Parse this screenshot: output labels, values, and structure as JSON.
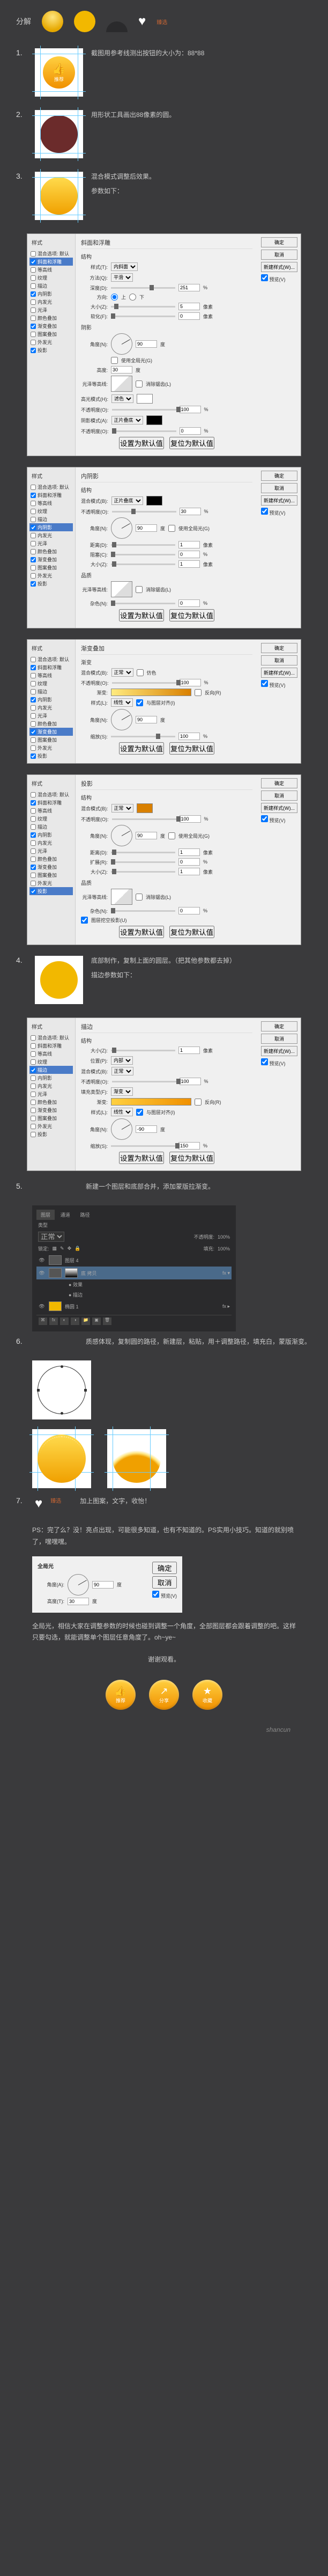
{
  "header": {
    "breakdown": "分解",
    "small": "臻选"
  },
  "steps": {
    "s1": {
      "num": "1.",
      "text": "截图用参考线测出按钮的大小为：88*88",
      "btn_label": "推荐"
    },
    "s2": {
      "num": "2.",
      "text": "用形状工具画出88像素的圆。"
    },
    "s3": {
      "num": "3.",
      "text": "混合模式调整后效果。",
      "params": "参数如下："
    },
    "s4": {
      "num": "4.",
      "text1": "底部制作，复制上面的圆层。（把其他参数都去掉）",
      "text2": "描边参数如下："
    },
    "s5": {
      "num": "5.",
      "text": "新建一个图层和底部合并，添加蒙版拉渐变。"
    },
    "s6": {
      "num": "6.",
      "text": "质感体现，复制圆的路径，新建层，粘贴，用＋调整路径，填充白，蒙版渐变。"
    },
    "s7": {
      "num": "7.",
      "text": "加上图案，文字，收怡！"
    }
  },
  "dialog": {
    "styles_hdr": "样式",
    "items": [
      "混合选项: 默认",
      "斜面和浮雕",
      "等高线",
      "纹理",
      "描边",
      "内阴影",
      "内发光",
      "光泽",
      "颜色叠加",
      "渐变叠加",
      "图案叠加",
      "外发光",
      "投影"
    ],
    "btns": {
      "ok": "确定",
      "cancel": "取消",
      "new": "新建样式(W)...",
      "preview": "预览(V)"
    },
    "bevel": {
      "title": "斜面和浮雕",
      "struct": "结构",
      "style_l": "样式(T):",
      "style_v": "内斜面",
      "method_l": "方法(Q):",
      "method_v": "平滑",
      "depth_l": "深度(D):",
      "depth_v": "251",
      "unit_pct": "%",
      "dir_l": "方向:",
      "up": "上",
      "down": "下",
      "size_l": "大小(Z):",
      "size_v": "5",
      "unit_px": "像素",
      "soft_l": "软化(F):",
      "soft_v": "0",
      "shade": "阴影",
      "angle_l": "角度(N):",
      "angle_v": "90",
      "deg": "度",
      "global": "使用全局光(G)",
      "alt_l": "高度:",
      "alt_v": "30",
      "contour_l": "光泽等高线:",
      "anti": "消除锯齿(L)",
      "hmode_l": "高光模式(H):",
      "hmode_v": "滤色",
      "hopac_v": "100",
      "smode_l": "阴影模式(A):",
      "smode_v": "正片叠底",
      "sopac_v": "0",
      "opac_l": "不透明度(O):",
      "reset": "设置为默认值",
      "default": "复位为默认值"
    },
    "innershadow": {
      "title": "内阴影",
      "blend_l": "混合模式(B):",
      "blend_v": "正片叠底",
      "opac_v": "30",
      "angle_v": "90",
      "dist_l": "距离(D):",
      "dist_v": "1",
      "choke_l": "阻塞(C):",
      "choke_v": "0",
      "size_v": "1",
      "quality": "品质",
      "noise_l": "杂色(N):",
      "noise_v": "0"
    },
    "gradoverlay": {
      "title": "渐变叠加",
      "grad": "渐变",
      "blend_v": "正常",
      "dither": "仿色",
      "opac_v": "100",
      "grad_l": "渐变:",
      "reverse": "反向(R)",
      "style_l": "样式(L):",
      "style_v": "线性",
      "align": "与图层对齐(I)",
      "angle_v": "90",
      "scale_l": "缩放(S):",
      "scale_v": "100"
    },
    "dropshadow": {
      "title": "投影",
      "blend_v": "正常",
      "opac_v": "100",
      "angle_v": "90",
      "dist_v": "1",
      "spread_l": "扩展(R):",
      "spread_v": "0",
      "size_v": "1",
      "knockout": "图层挖空投影(U)"
    },
    "stroke": {
      "title": "描边",
      "size_v": "1",
      "pos_l": "位置(P):",
      "pos_v": "内部",
      "blend_v": "正常",
      "opac_v": "100",
      "fill_l": "填充类型(F):",
      "fill_v": "渐变",
      "angle_v": "-90",
      "scale_v": "150"
    }
  },
  "layers": {
    "tabs": [
      "图层",
      "通道",
      "路径"
    ],
    "kind": "类型",
    "mode": "正常",
    "opac_l": "不透明度:",
    "opac_v": "100%",
    "lock": "锁定:",
    "fill_l": "填充:",
    "fill_v": "100%",
    "rows": [
      "图层 4",
      "底 拷贝",
      "椭圆 1"
    ],
    "fx": "效果",
    "fx_item": "描边"
  },
  "ps_note": "PS：完了么？没！亮点出现，可能很多知道，也有不知道的。PS实用小技巧。知道的就别喷了，嘿嘿嘿。",
  "global": {
    "title": "全局光",
    "angle_l": "角度(A):",
    "angle_v": "90",
    "deg": "度",
    "alt_l": "高度(T):",
    "alt_v": "30",
    "ok": "确定",
    "cancel": "取消",
    "preview": "预览(V)"
  },
  "global_text": "全局光，相信大家在调整参数的时候也碰到调整一个角度，全部图层都会跟着调整的吧。这样只要勾选，就能调整单个图层任意角度了。oh~ye~",
  "thanks": "谢谢观看。",
  "final": {
    "b1": "推荐",
    "b2": "分享",
    "b3": "收藏"
  },
  "watermark": "shancun"
}
